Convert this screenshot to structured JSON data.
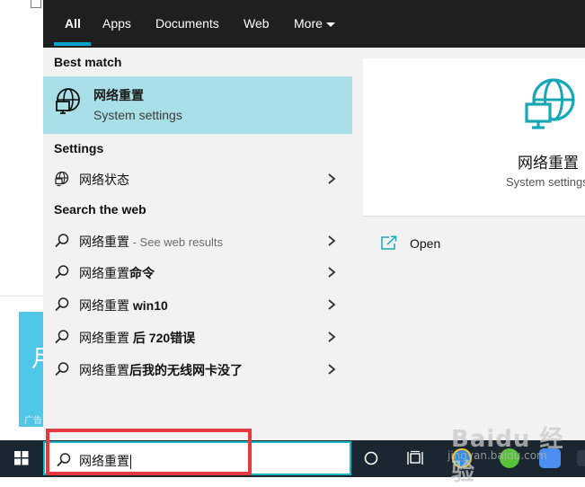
{
  "background": {
    "ad_glyph": "月",
    "ad_tag": "广告"
  },
  "tabs": [
    {
      "label": "All",
      "active": true
    },
    {
      "label": "Apps"
    },
    {
      "label": "Documents"
    },
    {
      "label": "Web"
    },
    {
      "label": "More"
    }
  ],
  "best_match": {
    "heading": "Best match",
    "title": "网络重置",
    "subtitle": "System settings",
    "icon": "network-globe-icon"
  },
  "settings": {
    "heading": "Settings",
    "items": [
      {
        "label": "网络状态",
        "icon": "globe-icon"
      }
    ]
  },
  "web": {
    "heading": "Search the web",
    "items": [
      {
        "label": "网络重置",
        "suffix": " - See web results"
      },
      {
        "label": "网络重置",
        "bold": "命令"
      },
      {
        "label": "网络重置 ",
        "bold": "win10"
      },
      {
        "label": "网络重置 ",
        "bold": "后 720错误"
      },
      {
        "label": "网络重置",
        "bold": "后我的无线网卡没了"
      }
    ]
  },
  "detail": {
    "title": "网络重置",
    "subtitle": "System settings",
    "open_label": "Open",
    "accent": "#17a8b8"
  },
  "search": {
    "value": "网络重置",
    "highlight_color": "#e5393f"
  },
  "watermark": {
    "brand": "Baidu 经验",
    "sub": "jingyan.baidu.com"
  }
}
